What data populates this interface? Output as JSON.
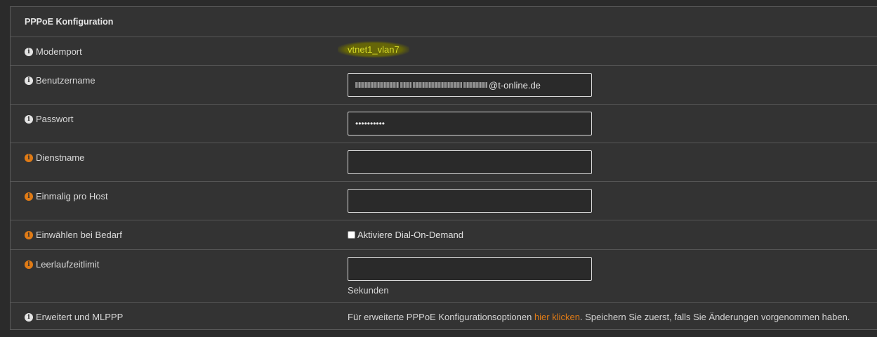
{
  "panel": {
    "title": "PPPoE Konfiguration"
  },
  "rows": {
    "modemport": {
      "label": "Modemport",
      "value": "vtnet1_vlan7",
      "icon": "info-icon",
      "icon_color": "#e4e4e4"
    },
    "benutzername": {
      "label": "Benutzername",
      "value_suffix": "@t-online.de",
      "icon": "info-icon",
      "icon_color": "#e4e4e4"
    },
    "passwort": {
      "label": "Passwort",
      "value": "••••••••••",
      "icon": "info-icon",
      "icon_color": "#e4e4e4"
    },
    "dienstname": {
      "label": "Dienstname",
      "value": "",
      "icon": "info-icon",
      "icon_color": "#e07b16"
    },
    "einmalig": {
      "label": "Einmalig pro Host",
      "value": "",
      "icon": "info-icon",
      "icon_color": "#e07b16"
    },
    "einwaehlen": {
      "label": "Einwählen bei Bedarf",
      "checkbox_label": "Aktiviere Dial-On-Demand",
      "checked": false,
      "icon": "info-icon",
      "icon_color": "#e07b16"
    },
    "leerlauf": {
      "label": "Leerlaufzeitlimit",
      "value": "",
      "unit": "Sekunden",
      "icon": "info-icon",
      "icon_color": "#e07b16"
    },
    "erweitert": {
      "label": "Erweitert und MLPPP",
      "text_before": "Für erweiterte PPPoE Konfigurationsoptionen ",
      "link_text": "hier klicken",
      "text_after": ". Speichern Sie zuerst, falls Sie Änderungen vorgenommen haben.",
      "icon": "info-icon",
      "icon_color": "#e4e4e4"
    }
  }
}
